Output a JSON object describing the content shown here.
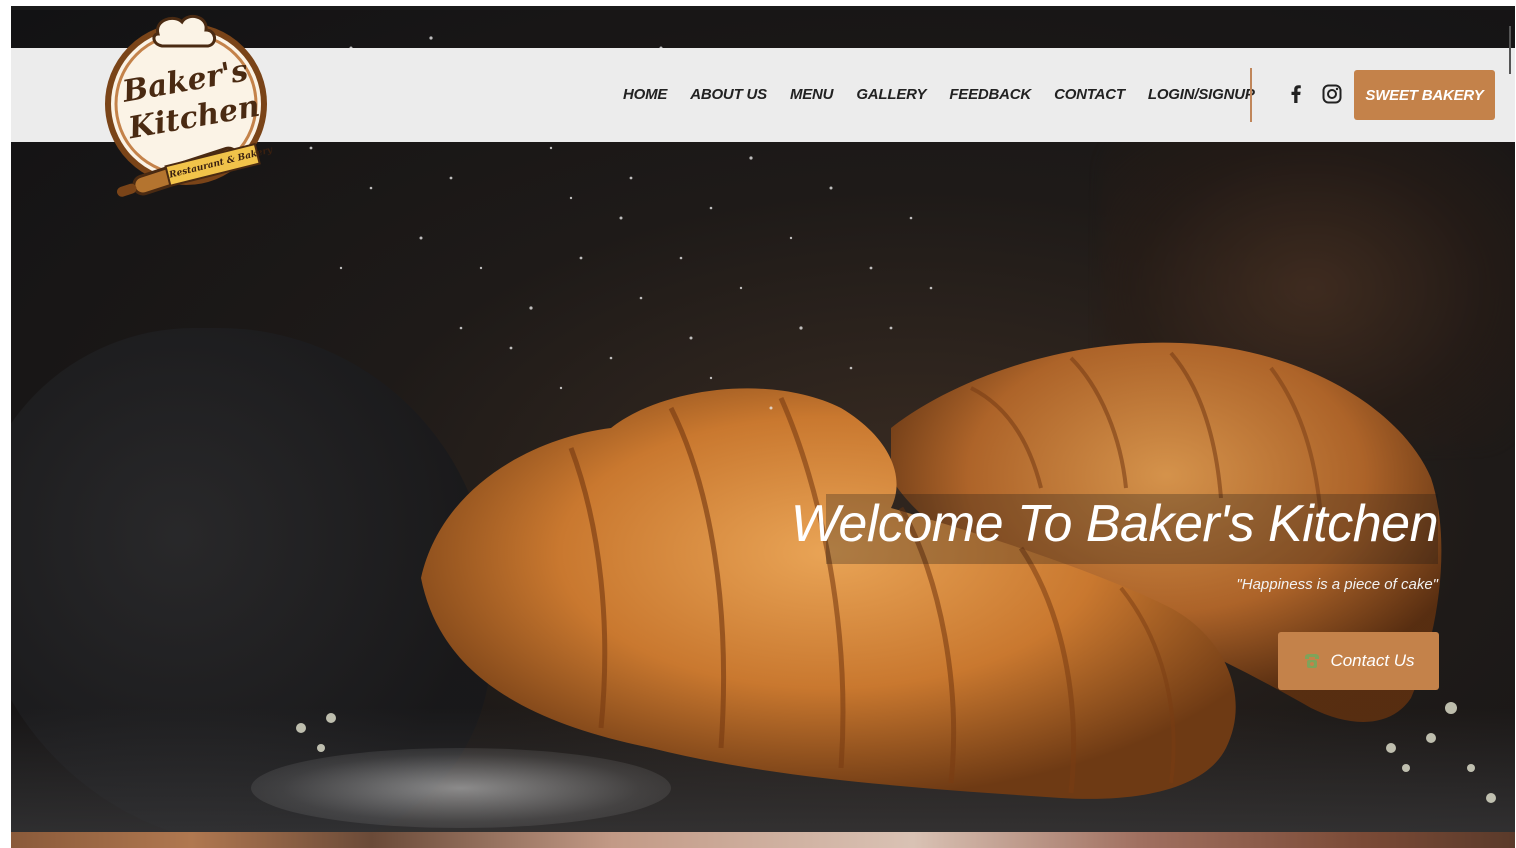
{
  "brand": {
    "logo_line1": "Baker's",
    "logo_line2": "Kitchen",
    "logo_ribbon": "Restaurant & Bakery"
  },
  "nav": {
    "items": [
      {
        "label": "HOME"
      },
      {
        "label": "ABOUT US"
      },
      {
        "label": "MENU"
      },
      {
        "label": "GALLERY"
      },
      {
        "label": "FEEDBACK"
      },
      {
        "label": "CONTACT"
      },
      {
        "label": "LOGIN/SIGNUP"
      }
    ],
    "social": [
      {
        "icon": "facebook-icon"
      },
      {
        "icon": "instagram-icon"
      }
    ],
    "cta_label": "SWEET BAKERY"
  },
  "hero": {
    "title": "Welcome To Baker's Kitchen",
    "tagline": "\"Happiness is a piece of cake\"",
    "button_label": "Contact Us",
    "button_icon": "phone-icon"
  },
  "colors": {
    "accent": "#c4824a",
    "navbar_bg": "#ececec",
    "nav_text": "#222222"
  }
}
